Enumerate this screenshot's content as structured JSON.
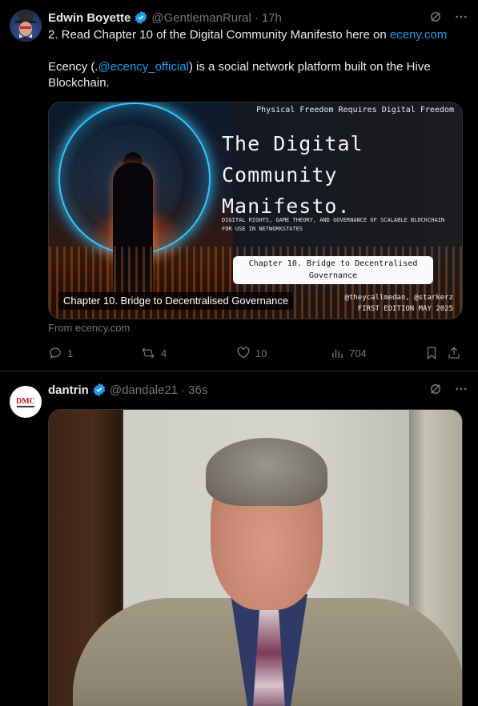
{
  "tweet1": {
    "author_name": "Edwin Boyette",
    "handle": "@GentlemanRural",
    "time": "17h",
    "line1_prefix": "2.  Read Chapter 10 of the Digital Community Manifesto here on ",
    "line1_link": "eceny.com",
    "line2_prefix": "Ecency (.",
    "line2_mention": "@ecency_official",
    "line2_suffix": ")  is a social network platform built on the Hive Blockchain.",
    "card": {
      "tagline": "Physical Freedom Requires Digital Freedom",
      "title_lines": [
        "The Digital",
        "Community",
        "Manifesto."
      ],
      "subtitle": "DIGITAL RIGHTS, GAME THEORY, AND GOVERNANCE OF SCALABLE BLOCKCHAIN FOR USE IN NETWORKSTATES",
      "chapter_pill_line1": "Chapter 10. Bridge to Decentralised",
      "chapter_pill_line2": "Governance",
      "credits_line1": "@theycallmedan, @starkerz",
      "credits_line2": "FIRST EDITION MAY 2025",
      "caption": "Chapter 10. Bridge to Decentralised Governance"
    },
    "from": "From ecency.com",
    "actions": {
      "replies": "1",
      "reposts": "4",
      "likes": "10",
      "views": "704"
    }
  },
  "tweet2": {
    "author_name": "dantrin",
    "handle": "@dandale21",
    "time": "36s",
    "avatar_text": "DMC"
  },
  "colors": {
    "background": "#000000",
    "text": "#e7e9ea",
    "muted": "#71767b",
    "link": "#1d9bf0",
    "border": "#2f3336"
  }
}
